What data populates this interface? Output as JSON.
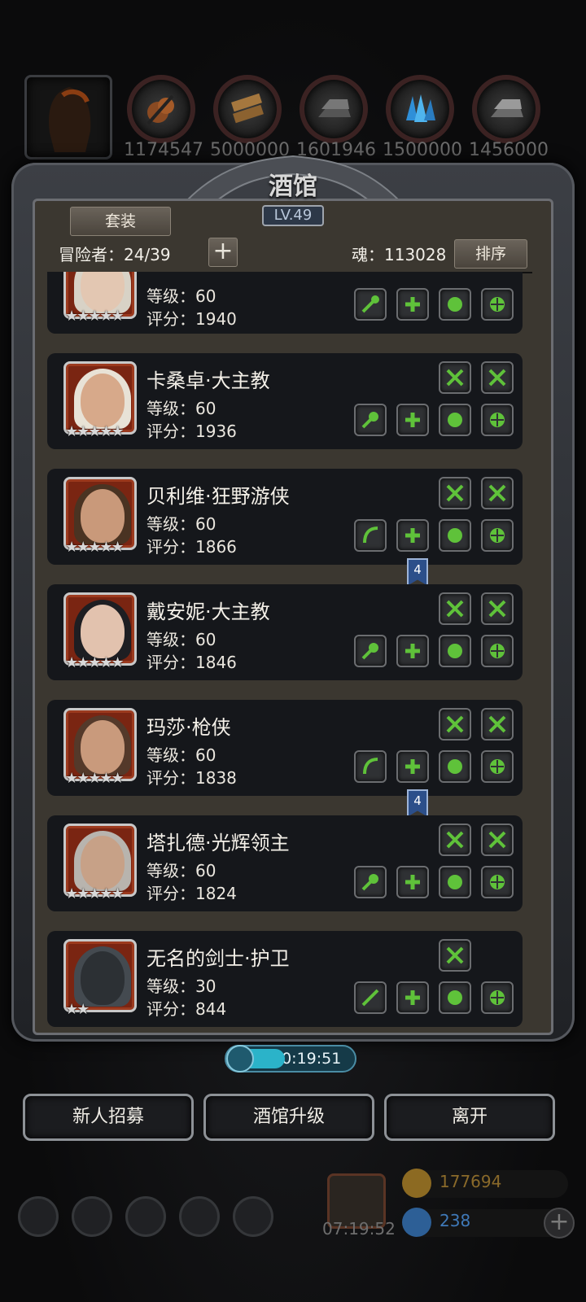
{
  "resources": [
    {
      "icon": "hammer-icon",
      "value": "1174547"
    },
    {
      "icon": "planks-icon",
      "value": "5000000"
    },
    {
      "icon": "iron-ingot-icon",
      "value": "1601946"
    },
    {
      "icon": "crystal-icon",
      "value": "1500000"
    },
    {
      "icon": "steel-icon",
      "value": "1456000"
    }
  ],
  "panel": {
    "title": "酒馆",
    "level": "LV.49",
    "set_button": "套装",
    "adventurers": "冒险者：24/39",
    "soul": "魂：113028",
    "sort_button": "排序"
  },
  "heroes": [
    {
      "name": "",
      "level": "等级：60",
      "score": "评分：1940",
      "stars": "★★★★★",
      "badge": ""
    },
    {
      "name": "卡桑卓·大主教",
      "level": "等级：60",
      "score": "评分：1936",
      "stars": "★★★★★",
      "badge": ""
    },
    {
      "name": "贝利维·狂野游侠",
      "level": "等级：60",
      "score": "评分：1866",
      "stars": "★★★★★",
      "badge": "4"
    },
    {
      "name": "戴安妮·大主教",
      "level": "等级：60",
      "score": "评分：1846",
      "stars": "★★★★★",
      "badge": ""
    },
    {
      "name": "玛莎·枪侠",
      "level": "等级：60",
      "score": "评分：1838",
      "stars": "★★★★★",
      "badge": "4"
    },
    {
      "name": "塔扎德·光辉领主",
      "level": "等级：60",
      "score": "评分：1824",
      "stars": "★★★★★",
      "badge": ""
    },
    {
      "name": "无名的剑士·护卫",
      "level": "等级：30",
      "score": "评分：844",
      "stars": "★★",
      "badge": ""
    }
  ],
  "timer": "00:19:51",
  "buttons": {
    "recruit": "新人招募",
    "upgrade": "酒馆升级",
    "leave": "离开"
  },
  "footer": {
    "gift_timer": "07:19:52",
    "gold": "177694",
    "gems": "238"
  },
  "colors": {
    "slot_green": "#5fc23a",
    "badge_blue": "#2c4f8a",
    "timer_cyan": "#2bb3c9",
    "gold_text": "#8a6a2a",
    "gem_text": "#3f79b8"
  }
}
